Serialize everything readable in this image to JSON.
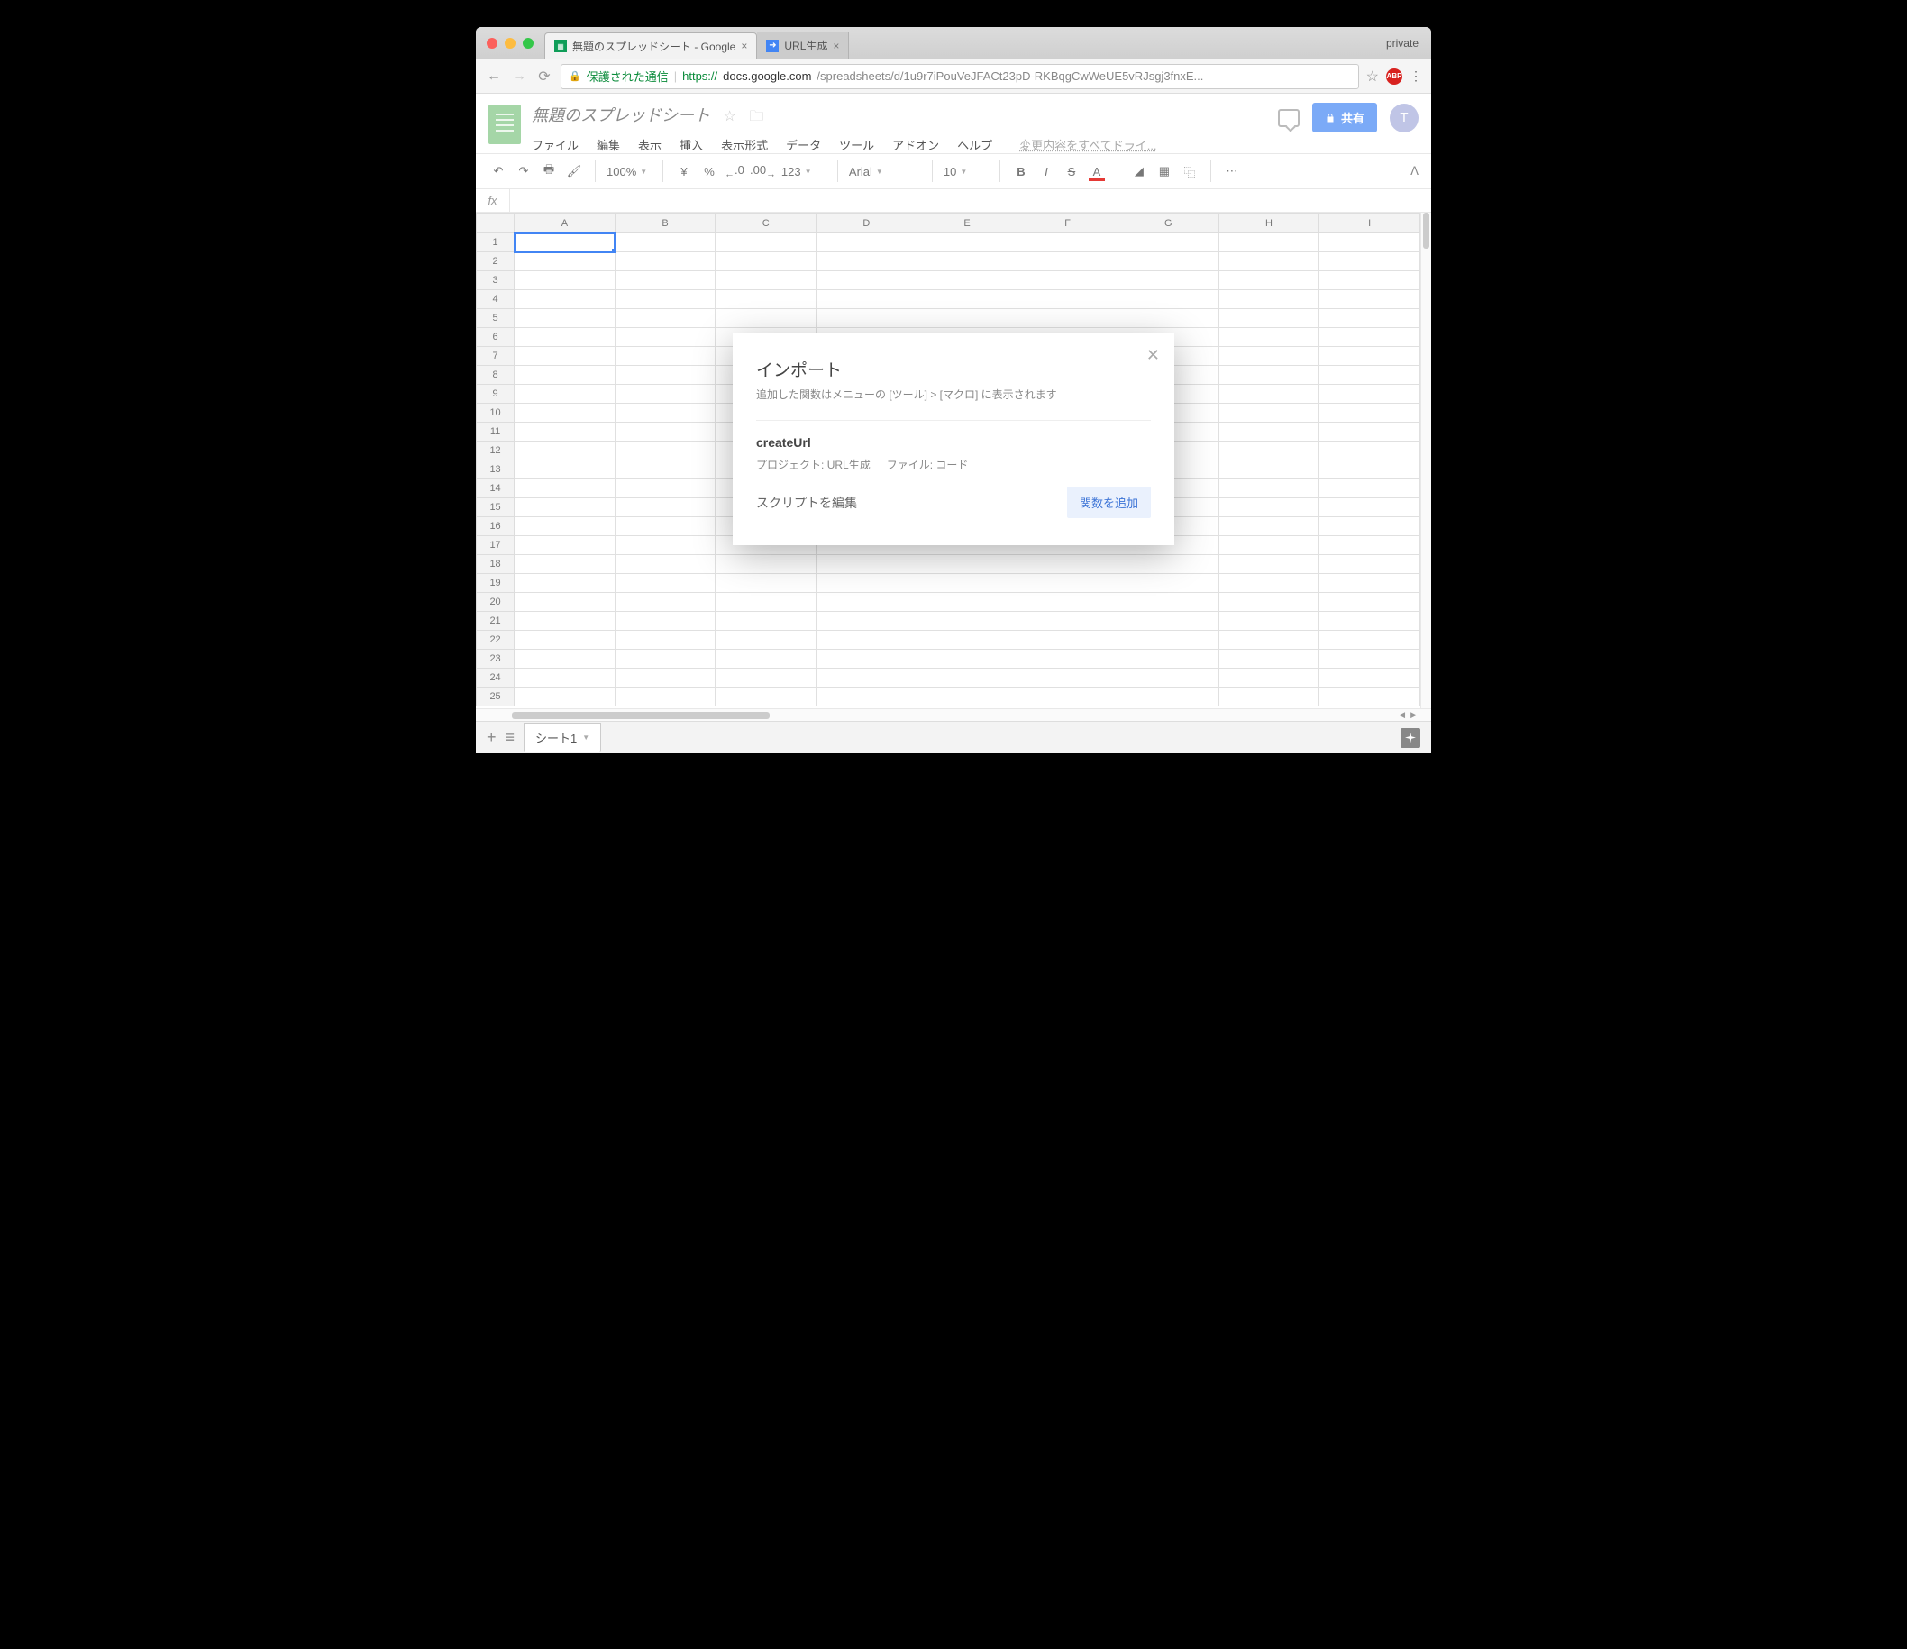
{
  "browser": {
    "profile": "private",
    "tabs": [
      {
        "title": "無題のスプレッドシート - Google",
        "active": true
      },
      {
        "title": "URL生成",
        "active": false
      }
    ],
    "address": {
      "secure_label": "保護された通信",
      "url_prefix": "https://",
      "url_host": "docs.google.com",
      "url_rest": "/spreadsheets/d/1u9r7iPouVeJFACt23pD-RKBqgCwWeUE5vRJsgj3fnxE..."
    },
    "ext_badge": "ABP"
  },
  "doc": {
    "title": "無題のスプレッドシート",
    "menus": [
      "ファイル",
      "編集",
      "表示",
      "挿入",
      "表示形式",
      "データ",
      "ツール",
      "アドオン",
      "ヘルプ"
    ],
    "save_status": "変更内容をすべてドライ...",
    "share_label": "共有",
    "avatar_letter": "T"
  },
  "toolbar": {
    "zoom": "100%",
    "currency_symbol": "¥",
    "percent": "%",
    "dec_dec": ".0",
    "dec_inc": ".00",
    "fmt_more": "123",
    "font": "Arial",
    "font_size": "10",
    "more": "⋯"
  },
  "formula_bar": {
    "fx": "fx"
  },
  "grid": {
    "columns": [
      "A",
      "B",
      "C",
      "D",
      "E",
      "F",
      "G",
      "H",
      "I"
    ],
    "rows": 25,
    "active_cell": "A1"
  },
  "sheet_tabs": {
    "sheets": [
      "シート1"
    ]
  },
  "modal": {
    "title": "インポート",
    "subtitle": "追加した関数はメニューの [ツール] > [マクロ] に表示されます",
    "function_name": "createUrl",
    "project_label": "プロジェクト:",
    "project_value": "URL生成",
    "file_label": "ファイル:",
    "file_value": "コード",
    "edit_script": "スクリプトを編集",
    "add_function": "関数を追加"
  }
}
